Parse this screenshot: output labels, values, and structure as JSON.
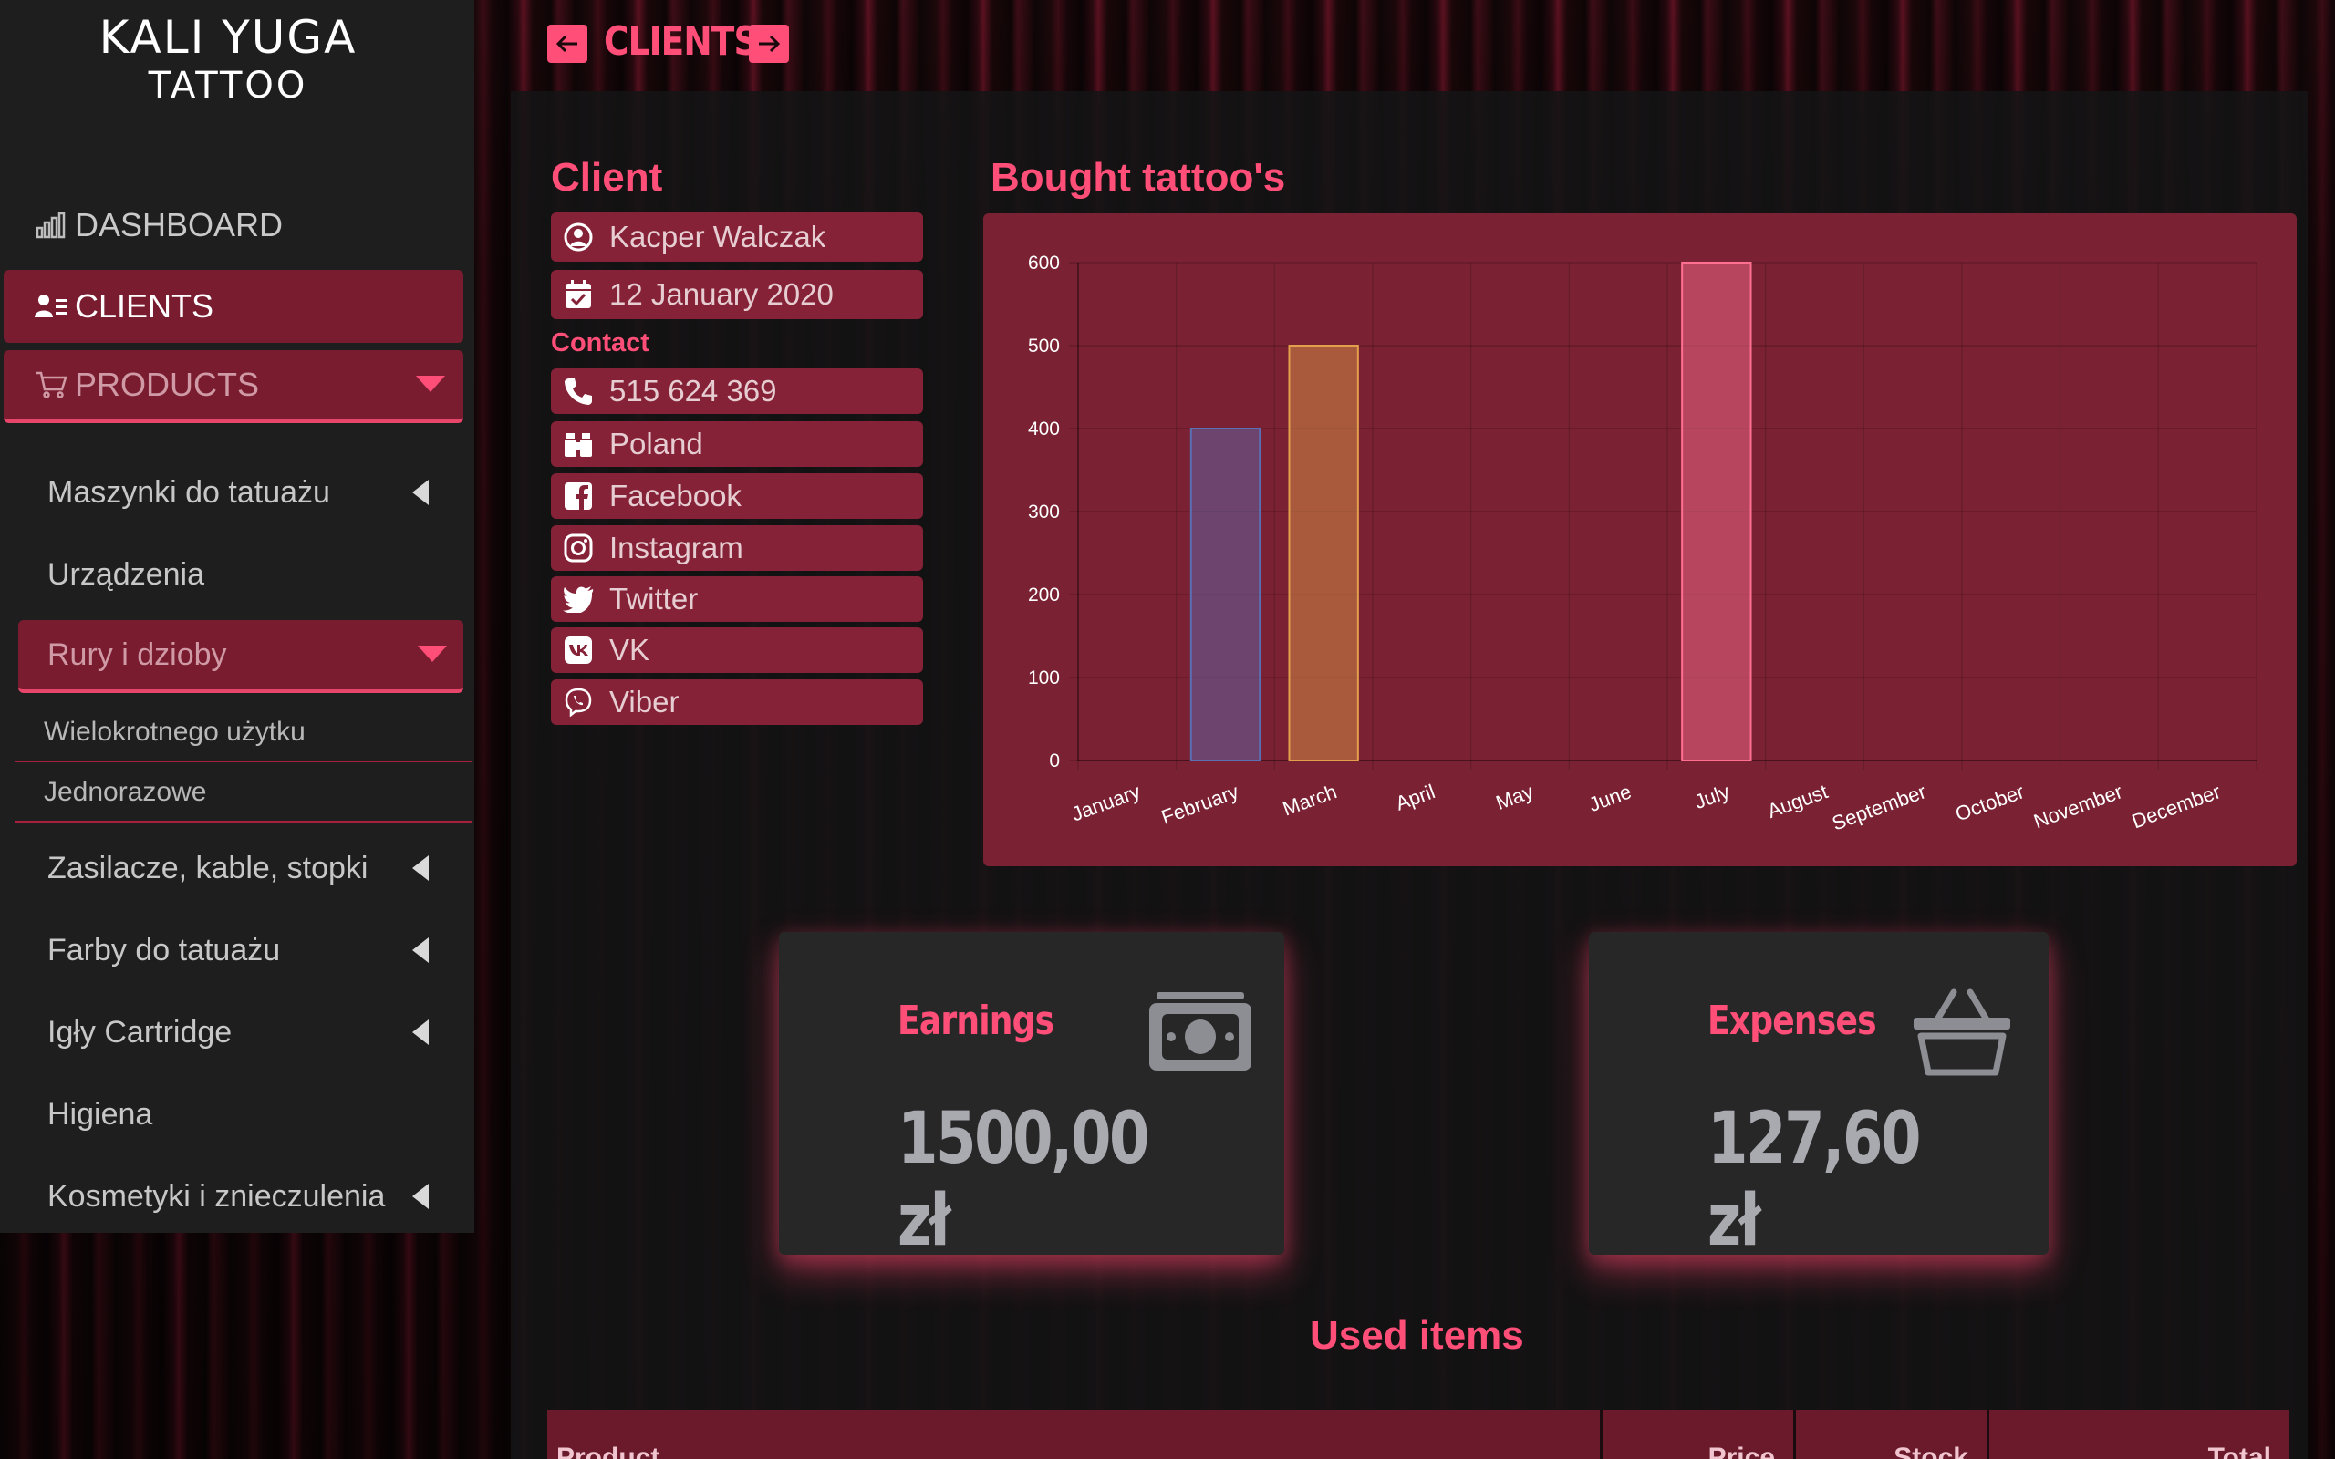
{
  "brand": {
    "line1": "KALI YUGA",
    "line2": "TATTOO"
  },
  "header": {
    "title": "CLIENTS"
  },
  "nav": {
    "dashboard": "DASHBOARD",
    "clients": "CLIENTS",
    "products": "PRODUCTS"
  },
  "categories": [
    "Maszynki do tatuażu",
    "Urządzenia",
    "Rury i dzioby",
    "Zasilacze, kable, stopki",
    "Farby do tatuażu",
    "Igły Cartridge",
    "Higiena",
    "Kosmetyki i znieczulenia"
  ],
  "subcategories": [
    "Wielokrotnego użytku",
    "Jednorazowe"
  ],
  "client": {
    "section_title": "Client",
    "name": "Kacper Walczak",
    "date": "12 January 2020",
    "contact_label": "Contact",
    "phone": "515 624 369",
    "country": "Poland",
    "facebook": "Facebook",
    "instagram": "Instagram",
    "twitter": "Twitter",
    "vk": "VK",
    "viber": "Viber"
  },
  "chart_title": "Bought tattoo's",
  "chart_data": {
    "type": "bar",
    "categories": [
      "January",
      "February",
      "March",
      "April",
      "May",
      "June",
      "July",
      "August",
      "September",
      "October",
      "November",
      "December"
    ],
    "values": [
      0,
      400,
      500,
      0,
      0,
      0,
      600,
      0,
      0,
      0,
      0,
      0
    ],
    "bar_colors": [
      "#5b6fb5",
      "#5b6fb5",
      "#e3a04a",
      "#9a3a4e",
      "#9a3a4e",
      "#9a3a4e",
      "#ff7090",
      "#9a3a4e",
      "#9a3a4e",
      "#9a3a4e",
      "#9a3a4e",
      "#9a3a4e"
    ],
    "ylim": [
      0,
      600
    ],
    "yticks": [
      0,
      100,
      200,
      300,
      400,
      500,
      600
    ],
    "grid": true,
    "legend": "none"
  },
  "earnings": {
    "label": "Earnings",
    "value": "1500,00 zł"
  },
  "expenses": {
    "label": "Expenses",
    "value": "127,60 zł"
  },
  "used_items": {
    "title": "Used items",
    "columns": [
      "Product",
      "Price",
      "Stock",
      "Total"
    ]
  },
  "colors": {
    "accent": "#ff4f78",
    "panel": "#862237",
    "sidebar": "#1e1e1f"
  }
}
